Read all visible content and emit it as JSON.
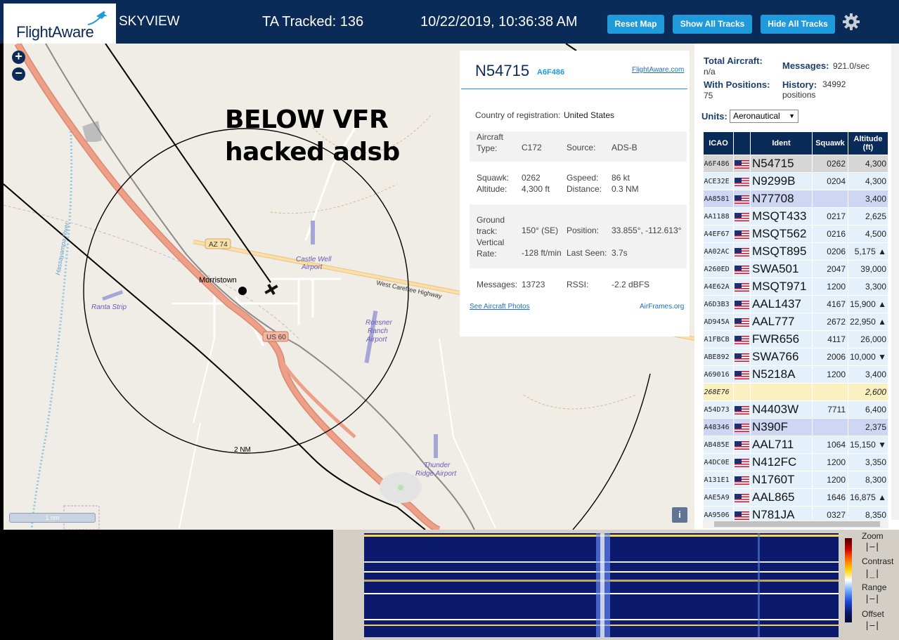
{
  "header": {
    "logo": "FlightAware",
    "site_name": "SKYVIEW",
    "tracked": "TA Tracked: 136",
    "datetime": "10/22/2019, 10:36:38 AM",
    "reset_map": "Reset Map",
    "show_all": "Show All Tracks",
    "hide_all": "Hide All Tracks"
  },
  "map": {
    "zoom_in": "+",
    "zoom_out": "−",
    "annotation_line1": "BELOW VFR",
    "annotation_line2": "hacked adsb",
    "scale": "1 nm",
    "range_ring_label": "2 NM",
    "road_az74": "AZ 74",
    "road_us60": "US 60",
    "road_carefree": "West Carefree Highway",
    "town": "Morristown",
    "airports": [
      "Castle Well Airport",
      "Ranta Strip",
      "Roesner Ranch Airport",
      "Thunder Ridge Airport"
    ],
    "river": "Hassayampa River",
    "info": "i"
  },
  "popup": {
    "ident": "N54715",
    "hex": "A6F486",
    "link": "FlightAware.com",
    "country_label": "Country of registration:",
    "country": "United States",
    "aircraft_type_label": "Aircraft Type:",
    "aircraft_type": "C172",
    "source_label": "Source:",
    "source": "ADS-B",
    "squawk_label": "Squawk:",
    "squawk": "0262",
    "gspeed_label": "Gspeed:",
    "gspeed": "86 kt",
    "altitude_label": "Altitude:",
    "altitude": "4,300 ft",
    "distance_label": "Distance:",
    "distance": "0.3 NM",
    "ground_track_label": "Ground track:",
    "ground_track": "150° (SE)",
    "position_label": "Position:",
    "position": "33.855°, -112.613°",
    "vrate_label": "Vertical Rate:",
    "vrate": "-128 ft/min",
    "last_seen_label": "Last Seen:",
    "last_seen": "3.7s",
    "messages_label": "Messages:",
    "messages": "13723",
    "rssi_label": "RSSI:",
    "rssi": "-2.2 dBFS",
    "photos_link": "See Aircraft Photos",
    "airframes_link": "AirFrames.org"
  },
  "sidebar": {
    "total_label": "Total Aircraft:",
    "total": "n/a",
    "messages_label": "Messages:",
    "messages": "921.0/sec",
    "with_pos_label": "With Positions:",
    "with_pos": "75",
    "history_label": "History:",
    "history": "34992 positions",
    "units_label": "Units:",
    "units": "Aeronautical",
    "columns": [
      "ICAO",
      "",
      "Ident",
      "Squawk",
      "Altitude (ft)"
    ],
    "rows": [
      {
        "icao": "A6F486",
        "flag": true,
        "ident": "N54715",
        "squawk": "0262",
        "alt": "4,300",
        "cls": "sel"
      },
      {
        "icao": "ACE32E",
        "flag": true,
        "ident": "N9299B",
        "squawk": "0204",
        "alt": "4,300",
        "cls": ""
      },
      {
        "icao": "AA8581",
        "flag": true,
        "ident": "N77708",
        "squawk": "",
        "alt": "3,400",
        "cls": "blue"
      },
      {
        "icao": "AA1188",
        "flag": true,
        "ident": "MSQT433",
        "squawk": "0217",
        "alt": "2,625",
        "cls": ""
      },
      {
        "icao": "A4EF67",
        "flag": true,
        "ident": "MSQT562",
        "squawk": "0216",
        "alt": "4,500",
        "cls": ""
      },
      {
        "icao": "AA02AC",
        "flag": true,
        "ident": "MSQT895",
        "squawk": "0206",
        "alt": "5,175 ▲",
        "cls": ""
      },
      {
        "icao": "A260ED",
        "flag": true,
        "ident": "SWA501",
        "squawk": "2047",
        "alt": "39,000",
        "cls": ""
      },
      {
        "icao": "A4E62A",
        "flag": true,
        "ident": "MSQT971",
        "squawk": "1200",
        "alt": "3,300",
        "cls": ""
      },
      {
        "icao": "A6D3B3",
        "flag": true,
        "ident": "AAL1437",
        "squawk": "4167",
        "alt": "15,900 ▲",
        "cls": ""
      },
      {
        "icao": "AD945A",
        "flag": true,
        "ident": "AAL777",
        "squawk": "2672",
        "alt": "22,950 ▲",
        "cls": ""
      },
      {
        "icao": "A1FBCB",
        "flag": true,
        "ident": "FWR656",
        "squawk": "4117",
        "alt": "26,000",
        "cls": ""
      },
      {
        "icao": "ABE892",
        "flag": true,
        "ident": "SWA766",
        "squawk": "2006",
        "alt": "10,000 ▼",
        "cls": ""
      },
      {
        "icao": "A69016",
        "flag": true,
        "ident": "N5218A",
        "squawk": "1200",
        "alt": "3,400",
        "cls": ""
      },
      {
        "icao": "268E76",
        "flag": false,
        "ident": "",
        "squawk": "",
        "alt": "2,600",
        "cls": "yel"
      },
      {
        "icao": "A54D73",
        "flag": true,
        "ident": "N4403W",
        "squawk": "7711",
        "alt": "6,400",
        "cls": ""
      },
      {
        "icao": "A48346",
        "flag": true,
        "ident": "N390F",
        "squawk": "",
        "alt": "2,375",
        "cls": "blue"
      },
      {
        "icao": "AB485E",
        "flag": true,
        "ident": "AAL711",
        "squawk": "1064",
        "alt": "15,150 ▼",
        "cls": ""
      },
      {
        "icao": "A4DC0E",
        "flag": true,
        "ident": "N412FC",
        "squawk": "1200",
        "alt": "3,350",
        "cls": ""
      },
      {
        "icao": "A131E1",
        "flag": true,
        "ident": "N1760T",
        "squawk": "1200",
        "alt": "8,300",
        "cls": ""
      },
      {
        "icao": "AAE5A9",
        "flag": true,
        "ident": "AAL865",
        "squawk": "1646",
        "alt": "16,875 ▲",
        "cls": ""
      },
      {
        "icao": "AA9506",
        "flag": true,
        "ident": "N781JA",
        "squawk": "0327",
        "alt": "8,350",
        "cls": ""
      }
    ]
  },
  "waterfall": {
    "zoom": "Zoom",
    "contrast": "Contrast",
    "range": "Range",
    "offset": "Offset"
  },
  "colors": {
    "header": "#0a2a57",
    "button": "#1f9bdc",
    "road": "#e8927c"
  }
}
